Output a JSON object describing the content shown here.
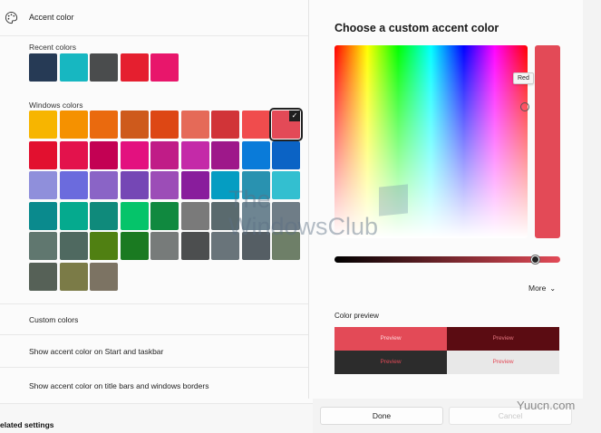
{
  "settings": {
    "accent_title": "Accent color",
    "recent_label": "Recent colors",
    "windows_label": "Windows colors",
    "custom_colors_label": "Custom colors",
    "taskbar_label": "Show accent color on Start and taskbar",
    "titlebar_label": "Show accent color on title bars and windows borders",
    "related_settings": "elated settings"
  },
  "recent_colors": [
    "#263a55",
    "#17b7c1",
    "#4a4c4d",
    "#e51f2f",
    "#e8166b"
  ],
  "windows_colors": [
    "#f7b500",
    "#f59100",
    "#ea6a0e",
    "#ce5a1c",
    "#dd4714",
    "#e56a58",
    "#d13438",
    "#f04c4d",
    "#e34a57",
    "#e2102f",
    "#e3124c",
    "#c30153",
    "#e3117f",
    "#c01c87",
    "#c42aa8",
    "#9e188a",
    "#0a7bd9",
    "#0b63c5",
    "#8f8fdb",
    "#6b6bdd",
    "#8a64c6",
    "#7547b5",
    "#9c4db7",
    "#891d9c",
    "#059dc2",
    "#2992b0",
    "#33bfd0",
    "#0a8a8d",
    "#05aa8e",
    "#0f8a7b",
    "#05c46a",
    "#10893f",
    "#7a7a7a",
    "#5a6a6e",
    "#6e8592",
    "#6f7d87",
    "#60776f",
    "#4f6960",
    "#508012",
    "#1a7a21",
    "#777b7a",
    "#4c4e4f",
    "#69747a",
    "#555e64",
    "#6e7f68",
    "#566157",
    "#7b7b47",
    "#7c7363"
  ],
  "selected_swatch_index": 8,
  "dialog": {
    "title": "Choose a custom accent color",
    "tooltip": "Red",
    "more_label": "More",
    "preview_label": "Color preview",
    "preview_text": "Preview",
    "done_label": "Done",
    "cancel_label": "Cancel"
  },
  "watermark": {
    "line1": "The",
    "line2": "WindowsClub",
    "site": "Yuucn.com"
  },
  "colors": {
    "accent": "#e34a57",
    "accent_dark": "#5b0c12"
  }
}
